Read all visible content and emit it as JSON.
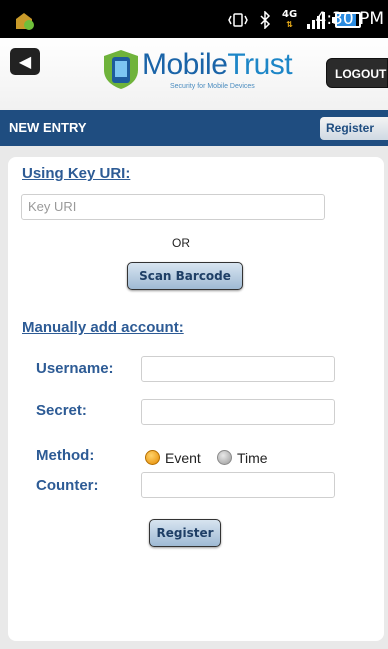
{
  "status_bar": {
    "time": "4:30 PM",
    "network": "4G",
    "icons": [
      "app-notification-icon",
      "vibrate-icon",
      "bluetooth-icon",
      "4g-icon",
      "signal-icon",
      "battery-icon"
    ]
  },
  "header": {
    "logo_text_prefix": "Mobile",
    "logo_text_suffix": "Trust",
    "logo_tagline": "Security for Mobile Devices",
    "logout_label": "LOGOUT"
  },
  "titlebar": {
    "title": "NEW ENTRY",
    "register_label": "Register"
  },
  "key_uri": {
    "heading": "Using Key URI:",
    "placeholder": "Key URI",
    "or_text": "OR",
    "scan_label": "Scan Barcode"
  },
  "manual": {
    "heading": "Manually add account:",
    "username_label": "Username:",
    "username_value": "",
    "secret_label": "Secret:",
    "secret_value": "",
    "method_label": "Method:",
    "method_options": [
      "Event",
      "Time"
    ],
    "method_selected": "Event",
    "counter_label": "Counter:",
    "counter_value": "",
    "register_label": "Register"
  },
  "colors": {
    "accent": "#1f4d80",
    "label": "#2d5b95",
    "radio_selected": "#e58a00"
  }
}
